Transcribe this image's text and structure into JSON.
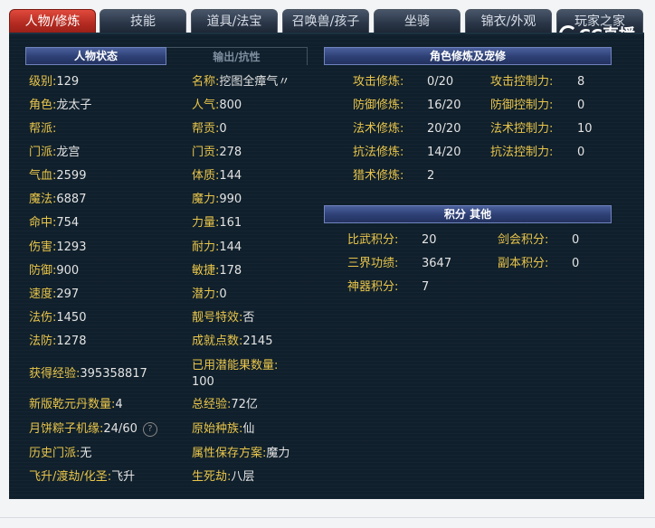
{
  "tabs": [
    {
      "label": "人物/修炼",
      "active": true
    },
    {
      "label": "技能",
      "active": false
    },
    {
      "label": "道具/法宝",
      "active": false
    },
    {
      "label": "召唤兽/孩子",
      "active": false
    },
    {
      "label": "坐骑",
      "active": false
    },
    {
      "label": "锦衣/外观",
      "active": false
    },
    {
      "label": "玩家之家",
      "active": false
    }
  ],
  "logo": {
    "text": "CC直播"
  },
  "left_section": {
    "title": "人物状态",
    "subtab": "输出/抗性"
  },
  "char_col1": [
    {
      "label": "级别:",
      "value": "129"
    },
    {
      "label": "角色:",
      "value": "龙太子"
    },
    {
      "label": "帮派:",
      "value": ""
    },
    {
      "label": "门派:",
      "value": "龙宫"
    },
    {
      "label": "气血:",
      "value": "2599"
    },
    {
      "label": "魔法:",
      "value": "6887"
    },
    {
      "label": "命中:",
      "value": "754"
    },
    {
      "label": "伤害:",
      "value": "1293"
    },
    {
      "label": "防御:",
      "value": "900"
    },
    {
      "label": "速度:",
      "value": "297"
    },
    {
      "label": "法伤:",
      "value": "1450"
    },
    {
      "label": "法防:",
      "value": "1278"
    }
  ],
  "char_col2": [
    {
      "label": "名称:",
      "value": "挖图全瘴气〃"
    },
    {
      "label": "人气:",
      "value": "800"
    },
    {
      "label": "帮贡:",
      "value": "0"
    },
    {
      "label": "门贡:",
      "value": "278"
    },
    {
      "label": "体质:",
      "value": "144"
    },
    {
      "label": "魔力:",
      "value": "990"
    },
    {
      "label": "力量:",
      "value": "161"
    },
    {
      "label": "耐力:",
      "value": "144"
    },
    {
      "label": "敏捷:",
      "value": "178"
    },
    {
      "label": "潜力:",
      "value": "0"
    },
    {
      "label": "靓号特效:",
      "value": "否"
    },
    {
      "label": "成就点数:",
      "value": "2145"
    }
  ],
  "extra": {
    "exp_label": "获得经验:",
    "exp_value": "395358817",
    "used_label": "已用潜能果数量:",
    "used_value": "100",
    "qy_label": "新版乾元丹数量:",
    "qy_value": "4",
    "total_exp_label": "总经验:",
    "total_exp_value": "72亿",
    "moon_label": "月饼粽子机缘:",
    "moon_value": "24/60",
    "help_icon": "?",
    "race_label": "原始种族:",
    "race_value": "仙",
    "history_label": "历史门派:",
    "history_value": "无",
    "save_label": "属性保存方案:",
    "save_value": "魔力",
    "fly_label": "飞升/渡劫/化圣:",
    "fly_value": "飞升",
    "life_label": "生死劫:",
    "life_value": "八层"
  },
  "cultivation": {
    "title": "角色修炼及宠修",
    "col1": [
      {
        "label": "攻击修炼:",
        "value": "0/20"
      },
      {
        "label": "防御修炼:",
        "value": "16/20"
      },
      {
        "label": "法术修炼:",
        "value": "20/20"
      },
      {
        "label": "抗法修炼:",
        "value": "14/20"
      },
      {
        "label": "猎术修炼:",
        "value": "2"
      }
    ],
    "col2": [
      {
        "label": "攻击控制力:",
        "value": "8"
      },
      {
        "label": "防御控制力:",
        "value": "0"
      },
      {
        "label": "法术控制力:",
        "value": "10"
      },
      {
        "label": "抗法控制力:",
        "value": "0"
      }
    ]
  },
  "points": {
    "title": "积分 其他",
    "col1": [
      {
        "label": "比武积分:",
        "value": "20"
      },
      {
        "label": "三界功绩:",
        "value": "3647"
      },
      {
        "label": "神器积分:",
        "value": "7"
      }
    ],
    "col2": [
      {
        "label": "剑会积分:",
        "value": "0"
      },
      {
        "label": "副本积分:",
        "value": "0"
      }
    ]
  }
}
